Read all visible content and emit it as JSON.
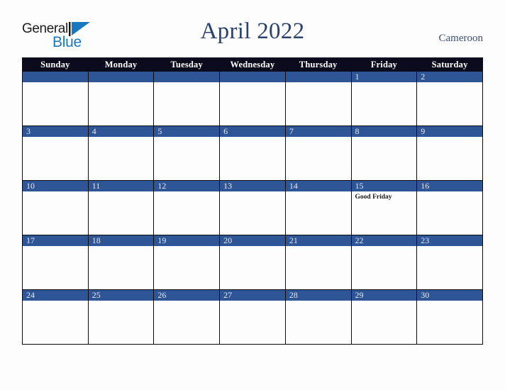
{
  "brand": {
    "word_one": "General",
    "word_two": "Blue",
    "triangle_icon": "blue-triangle-icon",
    "color_dark": "#1b1b1b",
    "color_blue": "#1878be"
  },
  "header": {
    "title": "April 2022",
    "country": "Cameroon",
    "title_color": "#2b4170"
  },
  "calendar": {
    "accent_band_color": "#2e5596",
    "header_bg_color": "#0b0b1d",
    "weekday_headers": [
      "Sunday",
      "Monday",
      "Tuesday",
      "Wednesday",
      "Thursday",
      "Friday",
      "Saturday"
    ],
    "weeks": [
      [
        {
          "day": "",
          "events": []
        },
        {
          "day": "",
          "events": []
        },
        {
          "day": "",
          "events": []
        },
        {
          "day": "",
          "events": []
        },
        {
          "day": "",
          "events": []
        },
        {
          "day": "1",
          "events": []
        },
        {
          "day": "2",
          "events": []
        }
      ],
      [
        {
          "day": "3",
          "events": []
        },
        {
          "day": "4",
          "events": []
        },
        {
          "day": "5",
          "events": []
        },
        {
          "day": "6",
          "events": []
        },
        {
          "day": "7",
          "events": []
        },
        {
          "day": "8",
          "events": []
        },
        {
          "day": "9",
          "events": []
        }
      ],
      [
        {
          "day": "10",
          "events": []
        },
        {
          "day": "11",
          "events": []
        },
        {
          "day": "12",
          "events": []
        },
        {
          "day": "13",
          "events": []
        },
        {
          "day": "14",
          "events": []
        },
        {
          "day": "15",
          "events": [
            "Good Friday"
          ]
        },
        {
          "day": "16",
          "events": []
        }
      ],
      [
        {
          "day": "17",
          "events": []
        },
        {
          "day": "18",
          "events": []
        },
        {
          "day": "19",
          "events": []
        },
        {
          "day": "20",
          "events": []
        },
        {
          "day": "21",
          "events": []
        },
        {
          "day": "22",
          "events": []
        },
        {
          "day": "23",
          "events": []
        }
      ],
      [
        {
          "day": "24",
          "events": []
        },
        {
          "day": "25",
          "events": []
        },
        {
          "day": "26",
          "events": []
        },
        {
          "day": "27",
          "events": []
        },
        {
          "day": "28",
          "events": []
        },
        {
          "day": "29",
          "events": []
        },
        {
          "day": "30",
          "events": []
        }
      ]
    ]
  }
}
